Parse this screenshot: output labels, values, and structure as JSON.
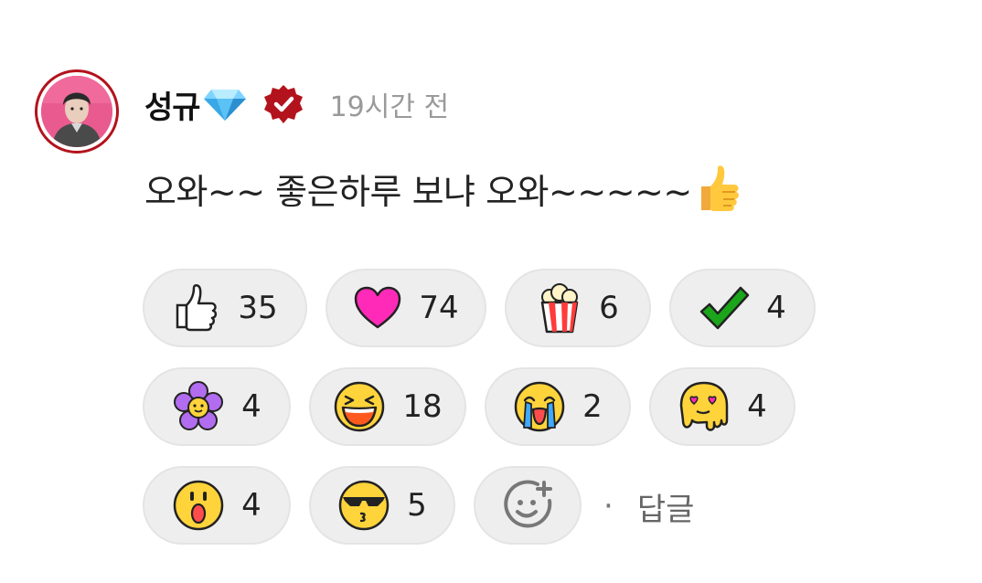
{
  "comment": {
    "author": "성규",
    "author_badge_icon": "gem-icon",
    "verified_icon": "verified-badge-icon",
    "time": "19시간 전",
    "text": "오와~~ 좋은하루 보냐 오와~~~~~",
    "trailing_emoji_icon": "thumbs-up-emoji-icon"
  },
  "reactions": [
    {
      "icon": "thumbs-up-icon",
      "count": "35"
    },
    {
      "icon": "heart-icon",
      "count": "74"
    },
    {
      "icon": "popcorn-icon",
      "count": "6"
    },
    {
      "icon": "check-icon",
      "count": "4"
    },
    {
      "icon": "flower-icon",
      "count": "4"
    },
    {
      "icon": "laughing-face-icon",
      "count": "18"
    },
    {
      "icon": "crying-face-icon",
      "count": "2"
    },
    {
      "icon": "melting-heart-eyes-icon",
      "count": "4"
    },
    {
      "icon": "surprised-face-icon",
      "count": "4"
    },
    {
      "icon": "sunglasses-kiss-icon",
      "count": "5"
    }
  ],
  "add_reaction_icon": "add-reaction-icon",
  "reply": {
    "separator": "·",
    "label": "답글"
  },
  "colors": {
    "verified_red": "#b3131c",
    "heart_pink": "#ff2bb8",
    "check_green": "#1aa51a",
    "flower_purple": "#b26cf0",
    "emoji_yellow": "#ffd43b",
    "pill_bg": "#eeeeee"
  }
}
